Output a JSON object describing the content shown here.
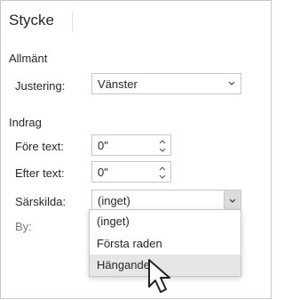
{
  "panel": {
    "title": "Stycke"
  },
  "general": {
    "heading": "Allmänt",
    "alignment_label": "Justering:",
    "alignment_value": "Vänster"
  },
  "indent": {
    "heading": "Indrag",
    "before_label": "Före text:",
    "before_value": "0\"",
    "after_label": "Efter text:",
    "after_value": "0\"",
    "special_label": "Särskilda:",
    "special_value": "(inget)",
    "by_label": "By:"
  },
  "special_dropdown": {
    "options": [
      "(inget)",
      "Första raden",
      "Hängande"
    ],
    "highlighted": "Hängande"
  },
  "colors": {
    "border": "#c6c6c6",
    "highlight": "#e6e6e6",
    "button": "#dcdcdc"
  }
}
